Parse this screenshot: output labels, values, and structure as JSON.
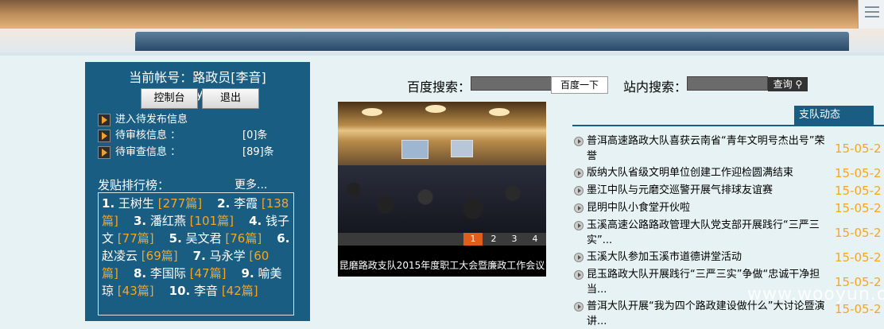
{
  "account": {
    "text": "当前帐号：路政员[李音][kmgs/yxddly]"
  },
  "buttons": {
    "console": "控制台",
    "logout": "退出"
  },
  "info": [
    {
      "label": "进入待发布信息",
      "value": ""
    },
    {
      "label": "待审核信息 ：",
      "value": "[0]条"
    },
    {
      "label": "待审查信息 ：",
      "value": "[89]条"
    }
  ],
  "ranking": {
    "title": "发贴排行榜：",
    "more": "更多...",
    "items": [
      {
        "num": "1",
        "name": "王树生",
        "count": "[277篇]"
      },
      {
        "num": "2",
        "name": "李霞",
        "count": "[138篇]"
      },
      {
        "num": "3",
        "name": "潘红燕",
        "count": "[101篇]"
      },
      {
        "num": "4",
        "name": "钱子文",
        "count": "[77篇]"
      },
      {
        "num": "5",
        "name": "吴文君",
        "count": "[76篇]"
      },
      {
        "num": "6",
        "name": "赵凌云",
        "count": "[69篇]"
      },
      {
        "num": "7",
        "name": "马永学",
        "count": "[60篇]"
      },
      {
        "num": "8",
        "name": "李国际",
        "count": "[47篇]"
      },
      {
        "num": "9",
        "name": "喻美琼",
        "count": "[43篇]"
      },
      {
        "num": "10",
        "name": "李音",
        "count": "[42篇]"
      }
    ]
  },
  "search": {
    "baidu_label": "百度搜索：",
    "baidu_button": "百度一下",
    "site_label": "站内搜索：",
    "site_button": "查询"
  },
  "slideshow": {
    "pages": [
      "1",
      "2",
      "3",
      "4"
    ],
    "active": "1",
    "caption": "昆磨路政支队2015年度职工大会暨廉政工作会议"
  },
  "news": {
    "tab": "支队动态",
    "items": [
      {
        "title": "普洱高速路政大队喜获云南省“青年文明号杰出号”荣誉",
        "date": "15-05-2"
      },
      {
        "title": "版纳大队省级文明单位创建工作迎检圆满结束",
        "date": "15-05-2"
      },
      {
        "title": "墨江中队与元磨交巡警开展气排球友谊赛",
        "date": "15-05-2"
      },
      {
        "title": "昆明中队小食堂开伙啦",
        "date": "15-05-2"
      },
      {
        "title": "玉溪高速公路路政管理大队党支部开展践行“三严三实”...",
        "date": "15-05-2"
      },
      {
        "title": "玉溪大队参加玉溪市道德讲堂活动",
        "date": "15-05-2"
      },
      {
        "title": "昆玉路政大队开展践行“三严三实”争做“忠诚干净担当...",
        "date": "15-05-2"
      },
      {
        "title": "普洱大队开展“我为四个路政建设做什么”大讨论暨演讲...",
        "date": "15-05-2"
      }
    ]
  },
  "watermark": "www.wooyun.org"
}
